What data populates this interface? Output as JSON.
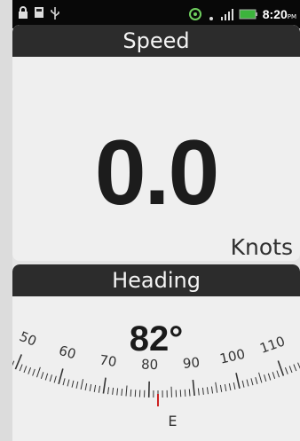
{
  "status_bar": {
    "left_icons": [
      "lock-icon",
      "card-icon",
      "usb-icon"
    ],
    "right_icons": [
      "sync-icon",
      "wifi-icon",
      "signal-icon",
      "battery-icon"
    ],
    "time": "8:20",
    "ampm": "PM",
    "battery_color": "#3cb43c"
  },
  "speed": {
    "title": "Speed",
    "value": "0.0",
    "unit": "Knots"
  },
  "heading": {
    "title": "Heading",
    "value": "82°",
    "compass": {
      "labels": [
        {
          "deg": 50,
          "text": "50"
        },
        {
          "deg": 60,
          "text": "60"
        },
        {
          "deg": 70,
          "text": "70"
        },
        {
          "deg": 80,
          "text": "80"
        },
        {
          "deg": 90,
          "text": "90"
        },
        {
          "deg": 100,
          "text": "100"
        },
        {
          "deg": 110,
          "text": "110"
        }
      ],
      "cardinal": {
        "deg": 90,
        "text": "E"
      },
      "pointer_color": "#cc2222"
    }
  }
}
